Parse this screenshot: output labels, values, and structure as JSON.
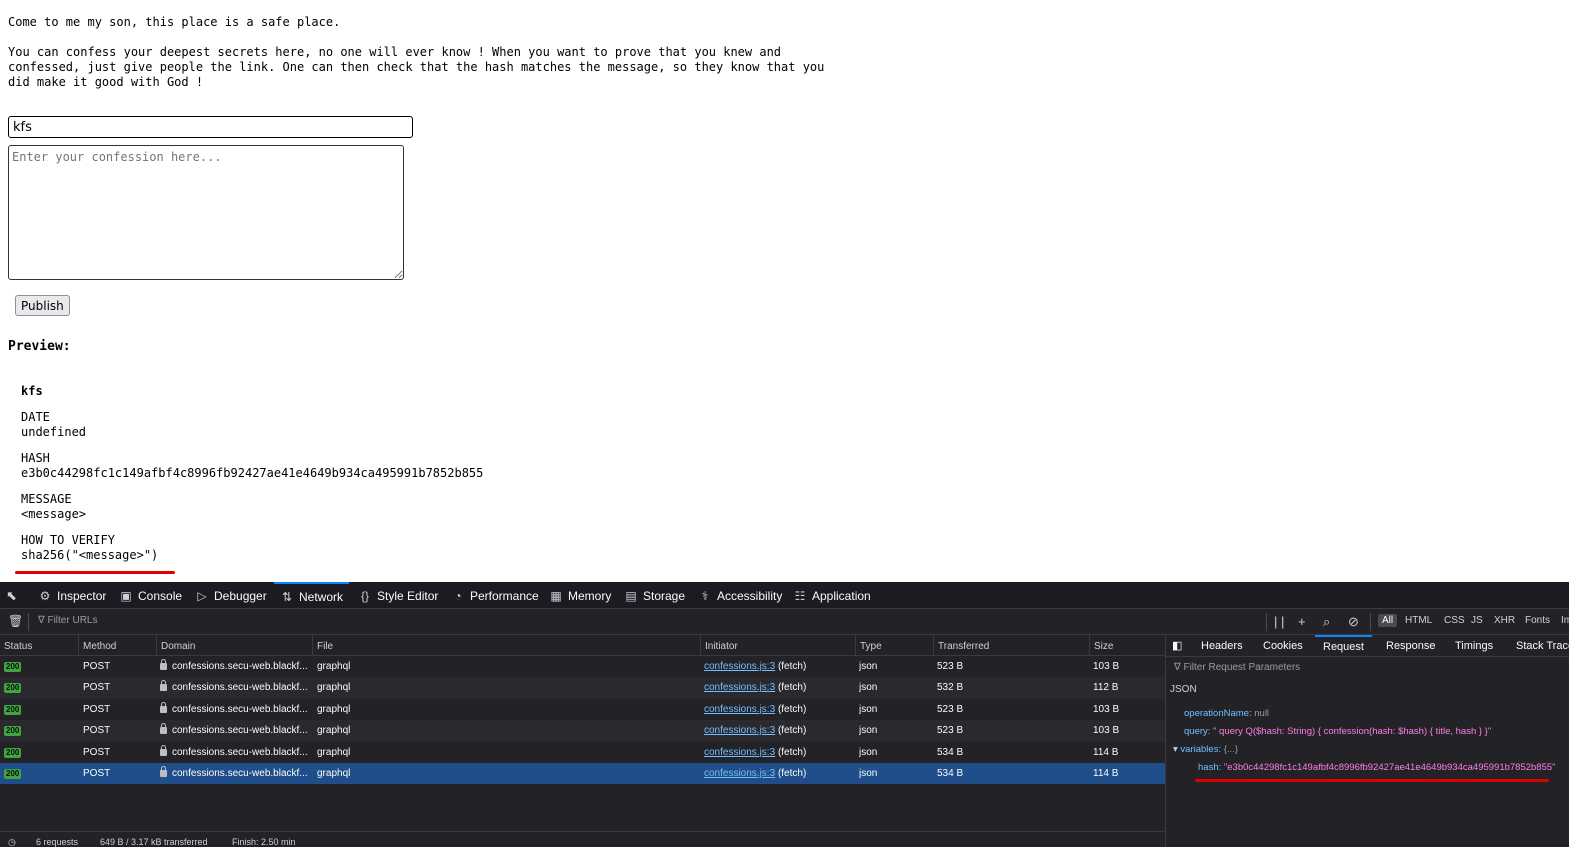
{
  "page": {
    "intro_line1": "Come to me my son, this place is a safe place.",
    "intro_line2": "You can confess your deepest secrets here, no one will ever know ! When you want to prove that you knew and\nconfessed, just give people the link. One can then check that the hash matches the message, so they know that you\ndid make it good with God !",
    "title_value": "kfs",
    "confession_placeholder": "Enter your confession here...",
    "publish_label": "Publish",
    "preview_heading": "Preview:",
    "preview": {
      "title": "kfs",
      "date_label": "DATE",
      "date_value": "undefined",
      "hash_label": "HASH",
      "hash_value": "e3b0c44298fc1c149afbf4c8996fb92427ae41e4649b934ca495991b7852b855",
      "message_label": "MESSAGE",
      "message_value": "<message>",
      "verify_label": "HOW TO VERIFY",
      "verify_value": "sha256(\"<message>\")"
    },
    "annotation_color": "#e00000"
  },
  "devtools": {
    "tabs": [
      {
        "label": "Inspector",
        "icon": "inspector-icon"
      },
      {
        "label": "Console",
        "icon": "console-icon"
      },
      {
        "label": "Debugger",
        "icon": "debugger-icon"
      },
      {
        "label": "Network",
        "icon": "network-icon"
      },
      {
        "label": "Style Editor",
        "icon": "style-editor-icon"
      },
      {
        "label": "Performance",
        "icon": "performance-icon"
      },
      {
        "label": "Memory",
        "icon": "memory-icon"
      },
      {
        "label": "Storage",
        "icon": "storage-icon"
      },
      {
        "label": "Accessibility",
        "icon": "accessibility-icon"
      },
      {
        "label": "Application",
        "icon": "application-icon"
      }
    ],
    "active_tab": "Network",
    "filter_placeholder": "Filter URLs",
    "type_filters": [
      "All",
      "HTML",
      "CSS",
      "JS",
      "XHR",
      "Fonts",
      "Im"
    ],
    "columns": [
      "Status",
      "Method",
      "Domain",
      "File",
      "Initiator",
      "Type",
      "Transferred",
      "Size"
    ],
    "rows": [
      {
        "status": "200",
        "method": "POST",
        "domain": "confessions.secu-web.blackf...",
        "file": "graphql",
        "initiator_link": "confessions.js:3",
        "initiator_kind": "(fetch)",
        "type": "json",
        "transferred": "523 B",
        "size": "103 B"
      },
      {
        "status": "200",
        "method": "POST",
        "domain": "confessions.secu-web.blackf...",
        "file": "graphql",
        "initiator_link": "confessions.js:3",
        "initiator_kind": "(fetch)",
        "type": "json",
        "transferred": "532 B",
        "size": "112 B"
      },
      {
        "status": "200",
        "method": "POST",
        "domain": "confessions.secu-web.blackf...",
        "file": "graphql",
        "initiator_link": "confessions.js:3",
        "initiator_kind": "(fetch)",
        "type": "json",
        "transferred": "523 B",
        "size": "103 B"
      },
      {
        "status": "200",
        "method": "POST",
        "domain": "confessions.secu-web.blackf...",
        "file": "graphql",
        "initiator_link": "confessions.js:3",
        "initiator_kind": "(fetch)",
        "type": "json",
        "transferred": "523 B",
        "size": "103 B"
      },
      {
        "status": "200",
        "method": "POST",
        "domain": "confessions.secu-web.blackf...",
        "file": "graphql",
        "initiator_link": "confessions.js:3",
        "initiator_kind": "(fetch)",
        "type": "json",
        "transferred": "534 B",
        "size": "114 B"
      },
      {
        "status": "200",
        "method": "POST",
        "domain": "confessions.secu-web.blackf...",
        "file": "graphql",
        "initiator_link": "confessions.js:3",
        "initiator_kind": "(fetch)",
        "type": "json",
        "transferred": "534 B",
        "size": "114 B"
      }
    ],
    "selected_row": 5,
    "statusbar": {
      "requests": "6 requests",
      "transferred": "649 B / 3.17 kB transferred",
      "finish": "Finish: 2.50 min"
    },
    "side_tabs": [
      "Headers",
      "Cookies",
      "Request",
      "Response",
      "Timings",
      "Stack Trace"
    ],
    "active_side_tab": "Request",
    "request_filter_placeholder": "Filter Request Parameters",
    "json_heading": "JSON",
    "json": {
      "operation_key": "operationName:",
      "operation_value": "null",
      "query_key": "query:",
      "query_value": "\" query Q($hash: String) { confession(hash: $hash) { title, hash } }\"",
      "variables_key": "variables:",
      "variables_value": "{...}",
      "hash_key": "hash:",
      "hash_value": "\"e3b0c44298fc1c149afbf4c8996fb92427ae41e4649b934ca495991b7852b855\""
    },
    "colors": {
      "panel_bg": "#232327",
      "selected_row": "#204e8a",
      "status_ok": "#3fa63f",
      "link": "#75bfff",
      "accent": "#0a84ff"
    }
  }
}
